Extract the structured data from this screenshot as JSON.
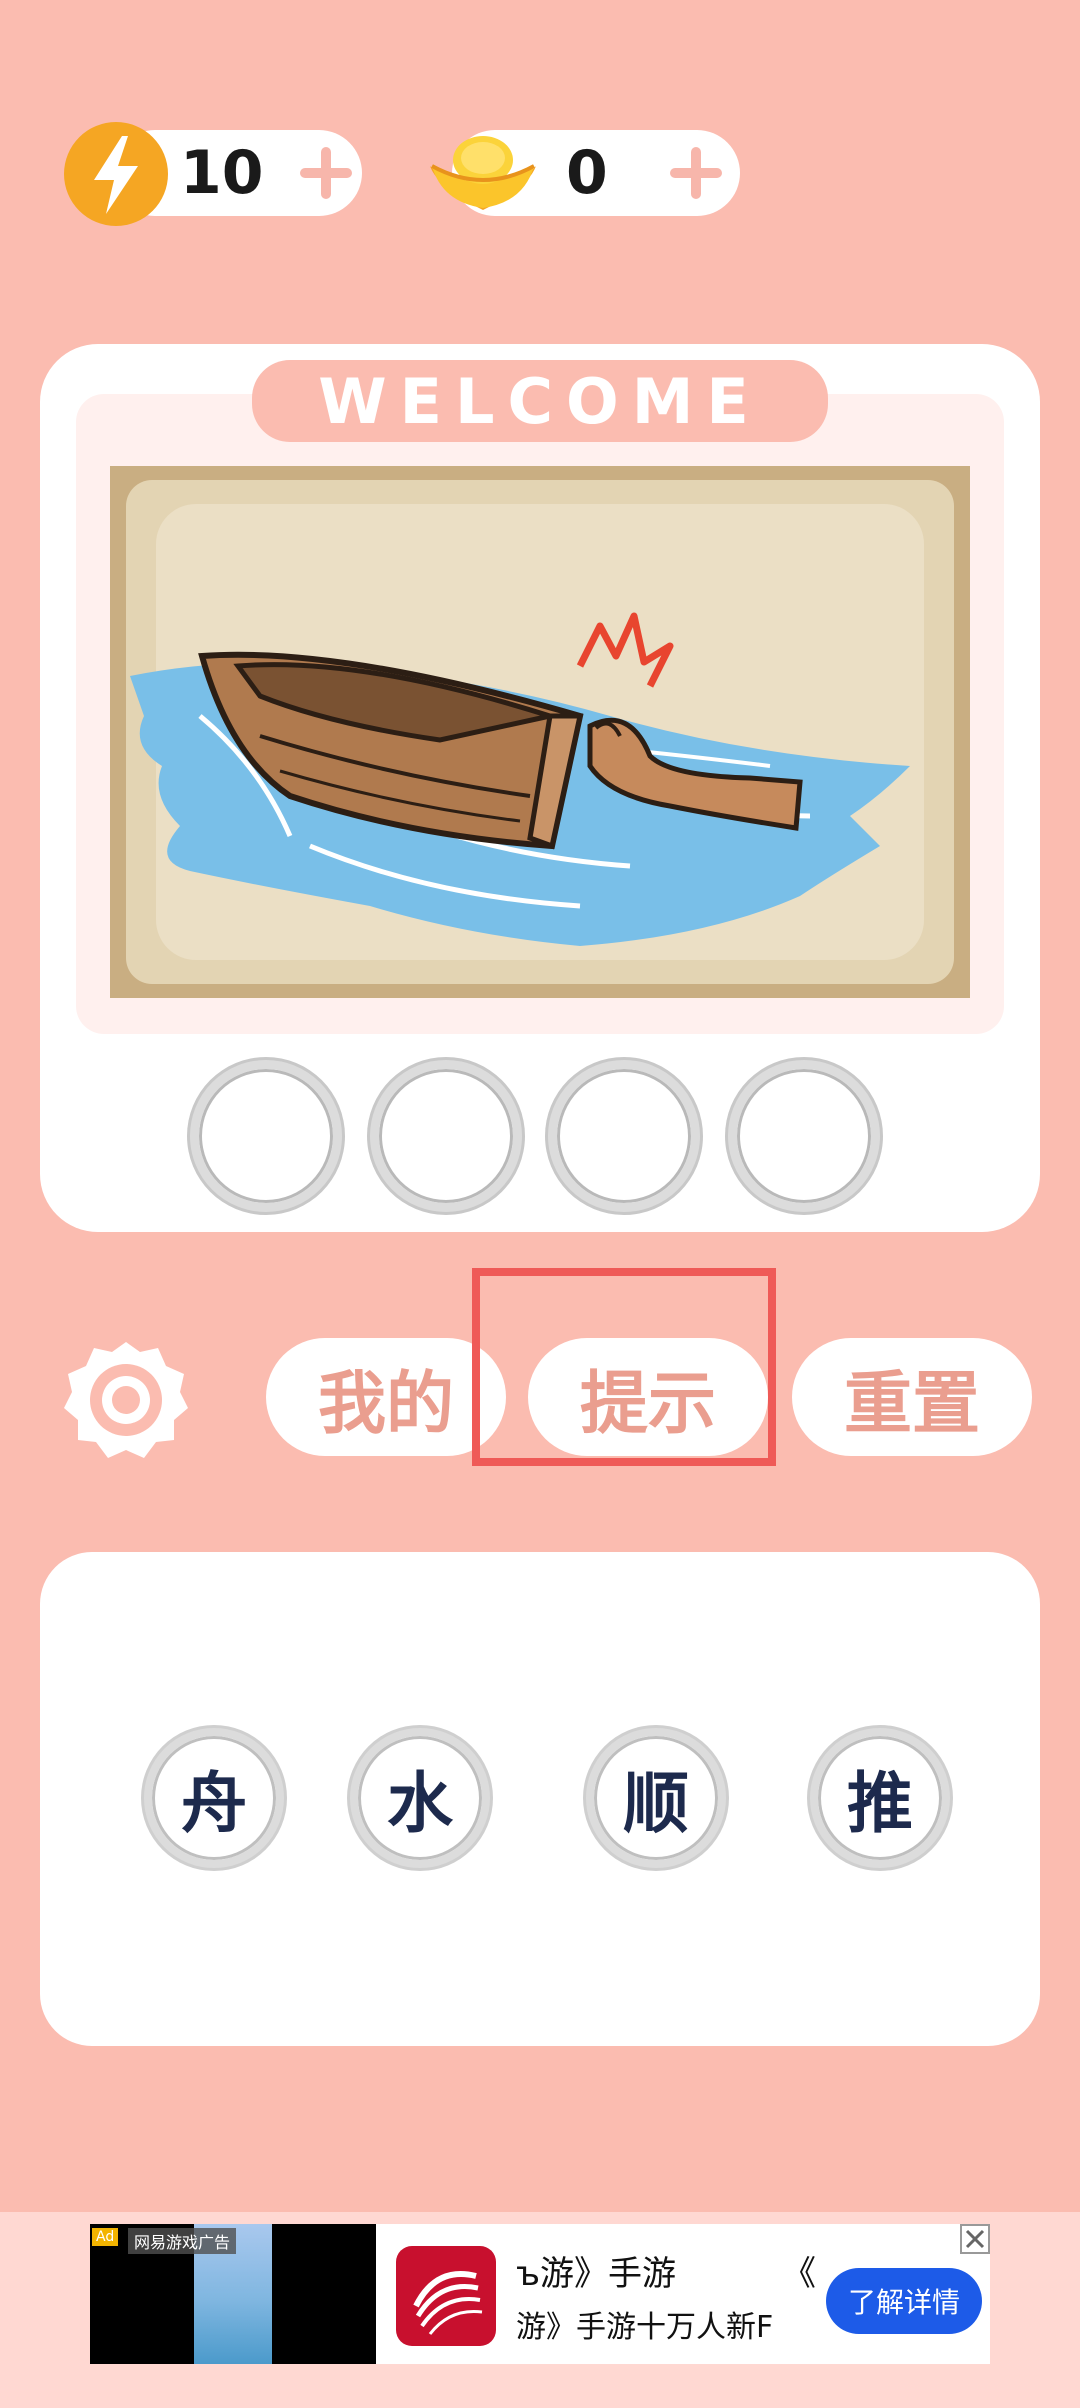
{
  "resources": {
    "energy": {
      "icon": "lightning-icon",
      "value": "10",
      "color": "#f5a623"
    },
    "gold": {
      "icon": "gold-ingot-icon",
      "value": "0",
      "color": "#f7c21b"
    }
  },
  "card": {
    "banner": "WELCOME",
    "puzzle_image": "boat-pushed-on-water-illustration",
    "answer_slots": [
      "",
      "",
      "",
      ""
    ]
  },
  "actions": {
    "settings_icon": "gear-icon",
    "mine_label": "我的",
    "hint_label": "提示",
    "reset_label": "重置",
    "highlight_color": "#ef5a57"
  },
  "choices": [
    "舟",
    "水",
    "顺",
    "推"
  ],
  "ad": {
    "tag": "Ad",
    "source": "网易游戏广告",
    "line1": "ъ游》手游",
    "line1_tail": "《",
    "line2": "游》手游十万人新F",
    "cta": "了解详情"
  }
}
